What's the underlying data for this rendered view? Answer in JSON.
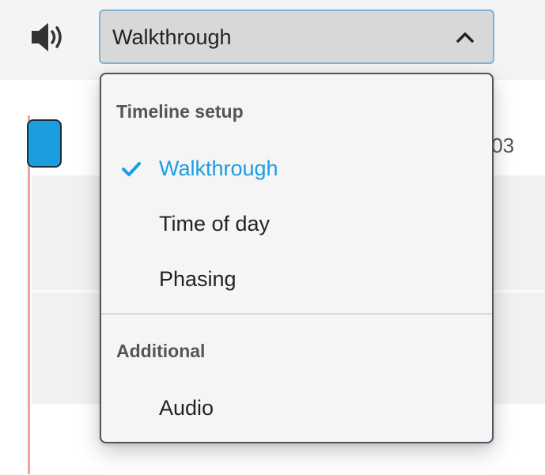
{
  "toolbar": {
    "speaker_icon": "speaker-volume-icon",
    "select": {
      "value": "Walkthrough",
      "icon": "chevron-up-icon"
    }
  },
  "timeline": {
    "time_readout": ":03",
    "playhead_color": "#1a9ee0"
  },
  "menu": {
    "sections": [
      {
        "header": "Timeline setup",
        "items": [
          {
            "label": "Walkthrough",
            "selected": true,
            "icon": "checkmark-icon"
          },
          {
            "label": "Time of day",
            "selected": false
          },
          {
            "label": "Phasing",
            "selected": false
          }
        ]
      },
      {
        "header": "Additional",
        "items": [
          {
            "label": "Audio",
            "selected": false
          }
        ]
      }
    ]
  },
  "colors": {
    "accent": "#1a9ee0",
    "select_border": "#7fb3d6",
    "playhead_line": "#f2a0a0"
  }
}
